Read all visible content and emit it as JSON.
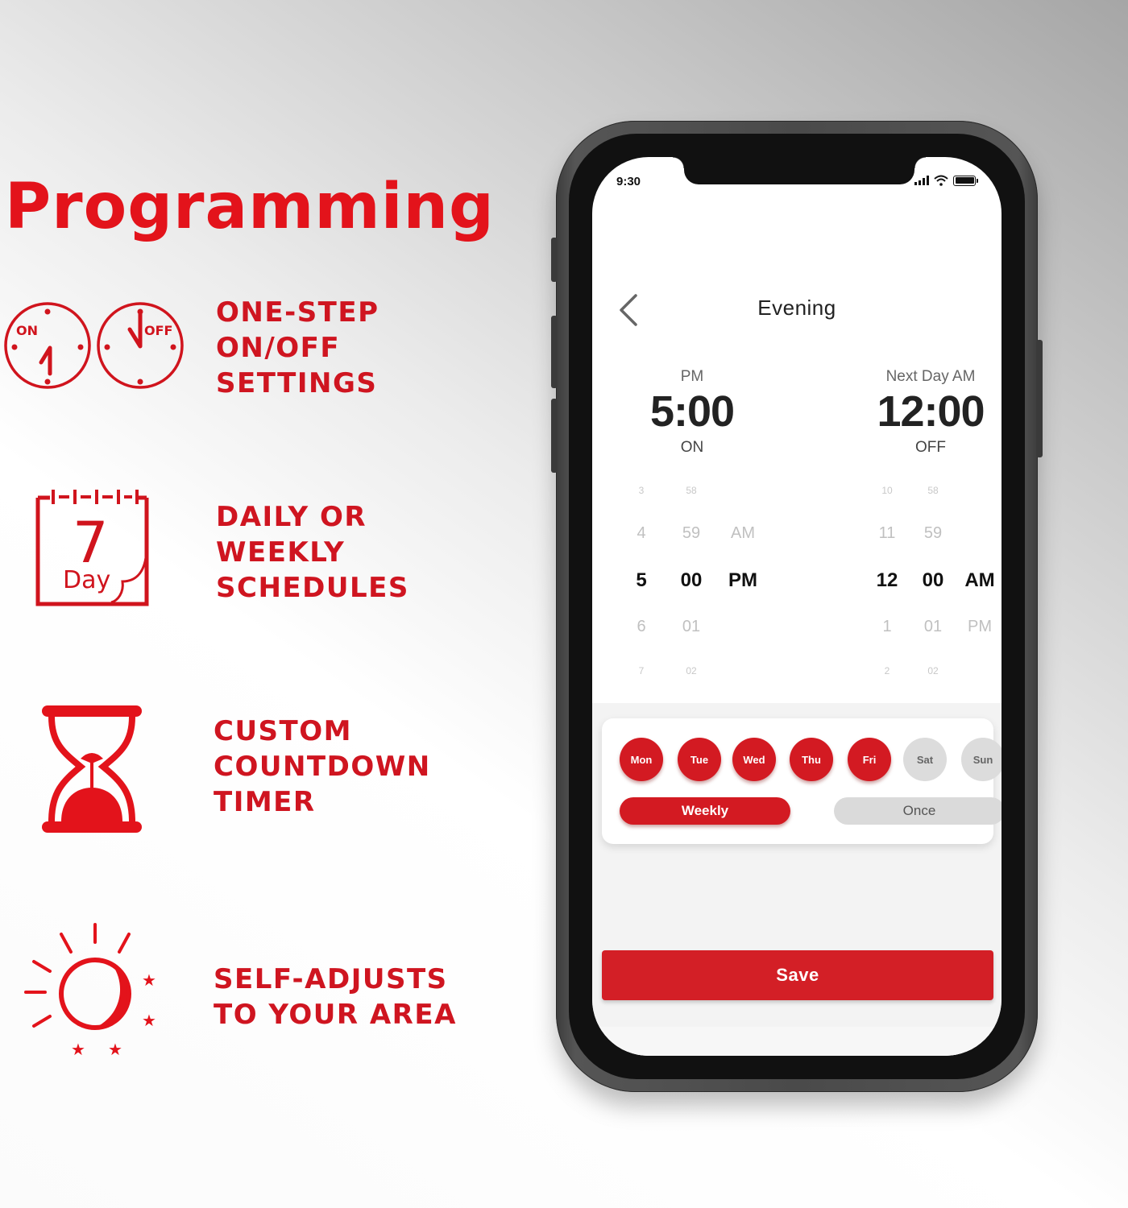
{
  "headline": "Programming",
  "brand_color": "#e3131b",
  "features": [
    {
      "icon": "on-off-clocks-icon",
      "lines": [
        "ONE-STEP",
        "ON/OFF",
        "SETTINGS"
      ],
      "icon_labels": {
        "on": "ON",
        "off": "OFF"
      }
    },
    {
      "icon": "seven-day-calendar-icon",
      "lines": [
        "DAILY OR",
        "WEEKLY",
        "SCHEDULES"
      ],
      "icon_labels": {
        "number": "7",
        "word": "Day"
      }
    },
    {
      "icon": "hourglass-icon",
      "lines": [
        "CUSTOM",
        "COUNTDOWN",
        "TIMER"
      ]
    },
    {
      "icon": "sun-moon-icon",
      "lines": [
        "SELF-ADJUSTS",
        "TO YOUR AREA"
      ]
    }
  ],
  "phone": {
    "status_bar": {
      "time": "9:30",
      "signal_icon": "cellular-signal-icon",
      "wifi_icon": "wifi-icon",
      "battery_icon": "battery-icon",
      "battery_level": 1.0
    },
    "header": {
      "back_icon": "chevron-left-icon",
      "title": "Evening"
    },
    "on_time": {
      "period": "PM",
      "time": "5:00",
      "state": "ON"
    },
    "off_time": {
      "period": "Next Day AM",
      "time": "12:00",
      "state": "OFF"
    },
    "on_picker": {
      "hours": [
        "3",
        "4",
        "5",
        "6",
        "7"
      ],
      "minutes": [
        "58",
        "59",
        "00",
        "01",
        "02"
      ],
      "meridiem": [
        "",
        "AM",
        "PM",
        "",
        ""
      ],
      "selected_index": 2
    },
    "off_picker": {
      "hours": [
        "10",
        "11",
        "12",
        "1",
        "2"
      ],
      "minutes": [
        "58",
        "59",
        "00",
        "01",
        "02"
      ],
      "meridiem": [
        "",
        "",
        "AM",
        "PM",
        ""
      ],
      "selected_index": 2
    },
    "days": [
      {
        "label": "Mon",
        "selected": true
      },
      {
        "label": "Tue",
        "selected": true
      },
      {
        "label": "Wed",
        "selected": true
      },
      {
        "label": "Thu",
        "selected": true
      },
      {
        "label": "Fri",
        "selected": true
      },
      {
        "label": "Sat",
        "selected": false
      },
      {
        "label": "Sun",
        "selected": false
      }
    ],
    "repeat_modes": [
      {
        "label": "Weekly",
        "selected": true
      },
      {
        "label": "Once",
        "selected": false
      }
    ],
    "save_label": "Save",
    "accent_color": "#d31a22"
  }
}
